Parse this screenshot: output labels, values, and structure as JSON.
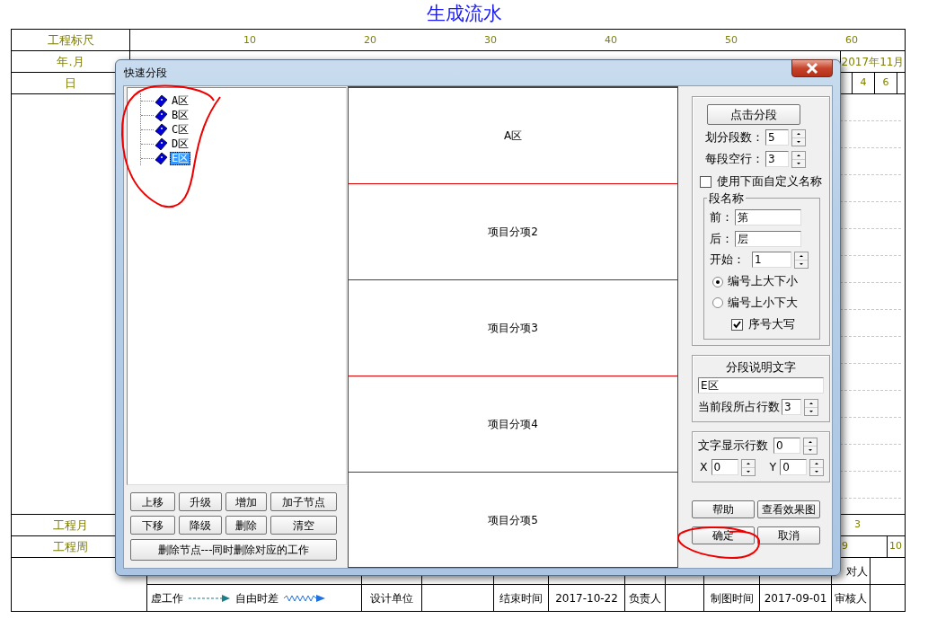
{
  "page_title": "生成流水",
  "ruler": {
    "label": "工程标尺",
    "ticks": [
      "10",
      "20",
      "30",
      "40",
      "50",
      "60"
    ]
  },
  "year_month": {
    "label": "年.月",
    "months": [
      "2017年11月"
    ]
  },
  "day": {
    "label": "日",
    "days": [
      "4",
      "6"
    ]
  },
  "project_month": {
    "label": "工程月",
    "values": [
      "3"
    ]
  },
  "project_week": {
    "label": "工程周",
    "values": [
      "9",
      "10"
    ]
  },
  "legend_top": {
    "text": "对人"
  },
  "legend_bottom": [
    {
      "kind": "legend",
      "items": [
        {
          "kind": "label",
          "text": "虚工作"
        },
        {
          "kind": "dashed-arrow"
        },
        {
          "kind": "label",
          "text": "自由时差"
        },
        {
          "kind": "wave-arrow"
        }
      ]
    },
    {
      "kind": "text",
      "text": "设计单位"
    },
    {
      "kind": "blank"
    },
    {
      "kind": "text",
      "text": "结束时间"
    },
    {
      "kind": "text",
      "text": "2017-10-22"
    },
    {
      "kind": "text",
      "text": "负责人"
    },
    {
      "kind": "blank"
    },
    {
      "kind": "text",
      "text": "制图时间"
    },
    {
      "kind": "text",
      "text": "2017-09-01"
    },
    {
      "kind": "text",
      "text": "审核人"
    },
    {
      "kind": "blank"
    }
  ],
  "dialog": {
    "title": "快速分段",
    "tree": [
      {
        "label": "A区",
        "selected": false
      },
      {
        "label": "B区",
        "selected": false
      },
      {
        "label": "C区",
        "selected": false
      },
      {
        "label": "D区",
        "selected": false
      },
      {
        "label": "E区",
        "selected": true
      }
    ],
    "tree_buttons": [
      "上移",
      "升级",
      "增加",
      "加子节点",
      "下移",
      "降级",
      "删除",
      "清空"
    ],
    "delete_button": "删除节点---同时删除对应的工作",
    "sections": [
      "A区",
      "项目分项2",
      "项目分项3",
      "项目分项4",
      "项目分项5"
    ],
    "split_button": "点击分段",
    "segment_count": {
      "label": "划分段数：",
      "value": "5"
    },
    "blank_rows": {
      "label": "每段空行：",
      "value": "3"
    },
    "use_custom_names": {
      "label": "使用下面自定义名称",
      "checked": false
    },
    "name_group": {
      "title": "段名称",
      "prefix": {
        "label": "前：",
        "value": "第"
      },
      "suffix": {
        "label": "后：",
        "value": "层"
      },
      "start": {
        "label": "开始：",
        "value": "1"
      },
      "order": [
        {
          "label": "编号上大下小",
          "selected": true
        },
        {
          "label": "编号上小下大",
          "selected": false
        }
      ],
      "uppercase": {
        "label": "序号大写",
        "checked": true
      }
    },
    "description_group": {
      "title": "分段说明文字",
      "text": "E区",
      "rows": {
        "label": "当前段所占行数",
        "value": "3"
      }
    },
    "display_group": {
      "rows": {
        "label": "文字显示行数",
        "value": "0"
      },
      "x": {
        "label": "X",
        "value": "0"
      },
      "y": {
        "label": "Y",
        "value": "0"
      }
    },
    "buttons": [
      "帮助",
      "查看效果图",
      "确定",
      "取消"
    ]
  }
}
